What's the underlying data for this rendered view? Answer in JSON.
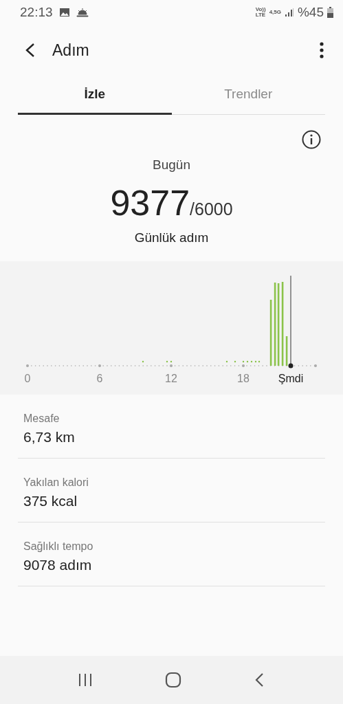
{
  "status_bar": {
    "time": "22:13",
    "network_top": "Vo))",
    "network_bottom": "LTE",
    "data_type": "4,5G",
    "battery": "%45"
  },
  "header": {
    "title": "Adım"
  },
  "tabs": [
    {
      "label": "İzle",
      "selected": true
    },
    {
      "label": "Trendler",
      "selected": false
    }
  ],
  "summary": {
    "period": "Bugün",
    "steps": "9377",
    "goal": "/6000",
    "caption": "Günlük adım"
  },
  "chart": {
    "axis_labels": [
      "0",
      "6",
      "12",
      "18"
    ],
    "now_label": "Şmdi"
  },
  "stats": [
    {
      "label": "Mesafe",
      "value": "6,73 km"
    },
    {
      "label": "Yakılan kalori",
      "value": "375 kcal"
    },
    {
      "label": "Sağlıklı tempo",
      "value": "9078 adım"
    }
  ]
}
